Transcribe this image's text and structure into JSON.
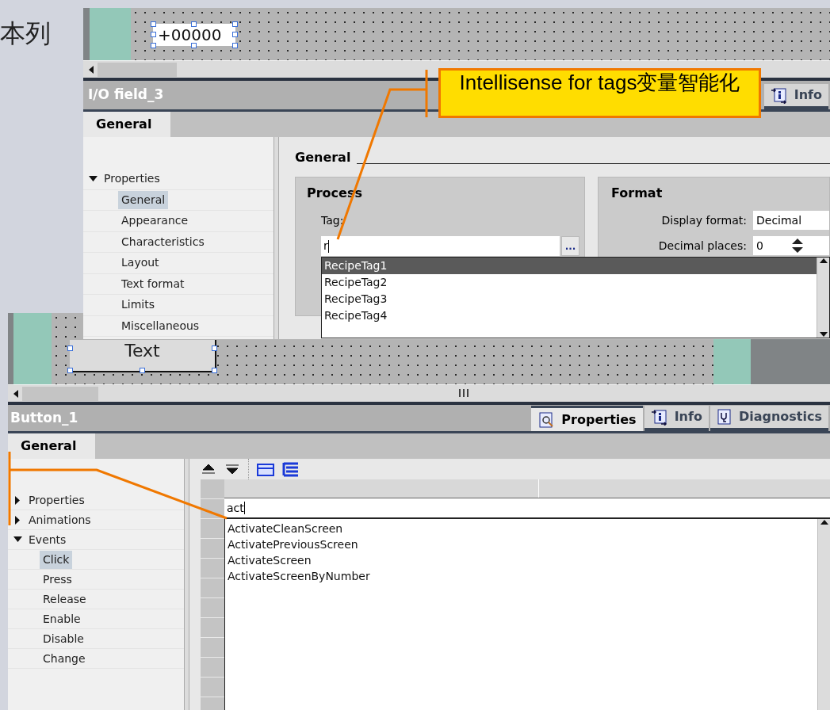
{
  "slide_text": "本列",
  "callout": "Intellisense for tags变量智能化",
  "top_editor": {
    "canvas": {
      "io_field_value": "+00000"
    },
    "title": "I/O field_3",
    "tabs": [
      {
        "label": "Info",
        "kind": "info",
        "selected": false
      }
    ],
    "subtabs": [
      {
        "label": "General",
        "selected": true
      }
    ],
    "nav": [
      {
        "label": "Properties",
        "expanded": true,
        "children": [
          {
            "label": "General",
            "selected": true
          },
          {
            "label": "Appearance",
            "selected": false
          },
          {
            "label": "Characteristics",
            "selected": false
          },
          {
            "label": "Layout",
            "selected": false
          },
          {
            "label": "Text format",
            "selected": false
          },
          {
            "label": "Limits",
            "selected": false
          },
          {
            "label": "Miscellaneous",
            "selected": false
          }
        ]
      }
    ],
    "section_title": "General",
    "process": {
      "title": "Process",
      "tag_label": "Tag:",
      "tag_value": "r",
      "browse": "...",
      "suggestions": [
        {
          "label": "RecipeTag1",
          "selected": true
        },
        {
          "label": "RecipeTag2",
          "selected": false
        },
        {
          "label": "RecipeTag3",
          "selected": false
        },
        {
          "label": "RecipeTag4",
          "selected": false
        }
      ]
    },
    "format": {
      "title": "Format",
      "display_format_label": "Display format:",
      "display_format_value": "Decimal",
      "decimal_places_label": "Decimal places:",
      "decimal_places_value": "0"
    }
  },
  "bottom_editor": {
    "canvas": {
      "button_text": "Text"
    },
    "title": "Button_1",
    "tabs": [
      {
        "label": "Properties",
        "kind": "properties",
        "selected": true
      },
      {
        "label": "Info",
        "kind": "info",
        "selected": false
      },
      {
        "label": "Diagnostics",
        "kind": "diagnostics",
        "selected": false
      }
    ],
    "subtabs": [
      {
        "label": "General",
        "selected": true
      }
    ],
    "nav": [
      {
        "label": "Properties",
        "expanded": false
      },
      {
        "label": "Animations",
        "expanded": false
      },
      {
        "label": "Events",
        "expanded": true,
        "children": [
          {
            "label": "Click",
            "selected": true
          },
          {
            "label": "Press",
            "selected": false
          },
          {
            "label": "Release",
            "selected": false
          },
          {
            "label": "Enable",
            "selected": false
          },
          {
            "label": "Disable",
            "selected": false
          },
          {
            "label": "Change",
            "selected": false
          }
        ]
      }
    ],
    "function_input": "act",
    "suggestions": [
      {
        "label": "ActivateCleanScreen",
        "selected": false
      },
      {
        "label": "ActivatePreviousScreen",
        "selected": false
      },
      {
        "label": "ActivateScreen",
        "selected": false
      },
      {
        "label": "ActivateScreenByNumber",
        "selected": false
      }
    ]
  }
}
